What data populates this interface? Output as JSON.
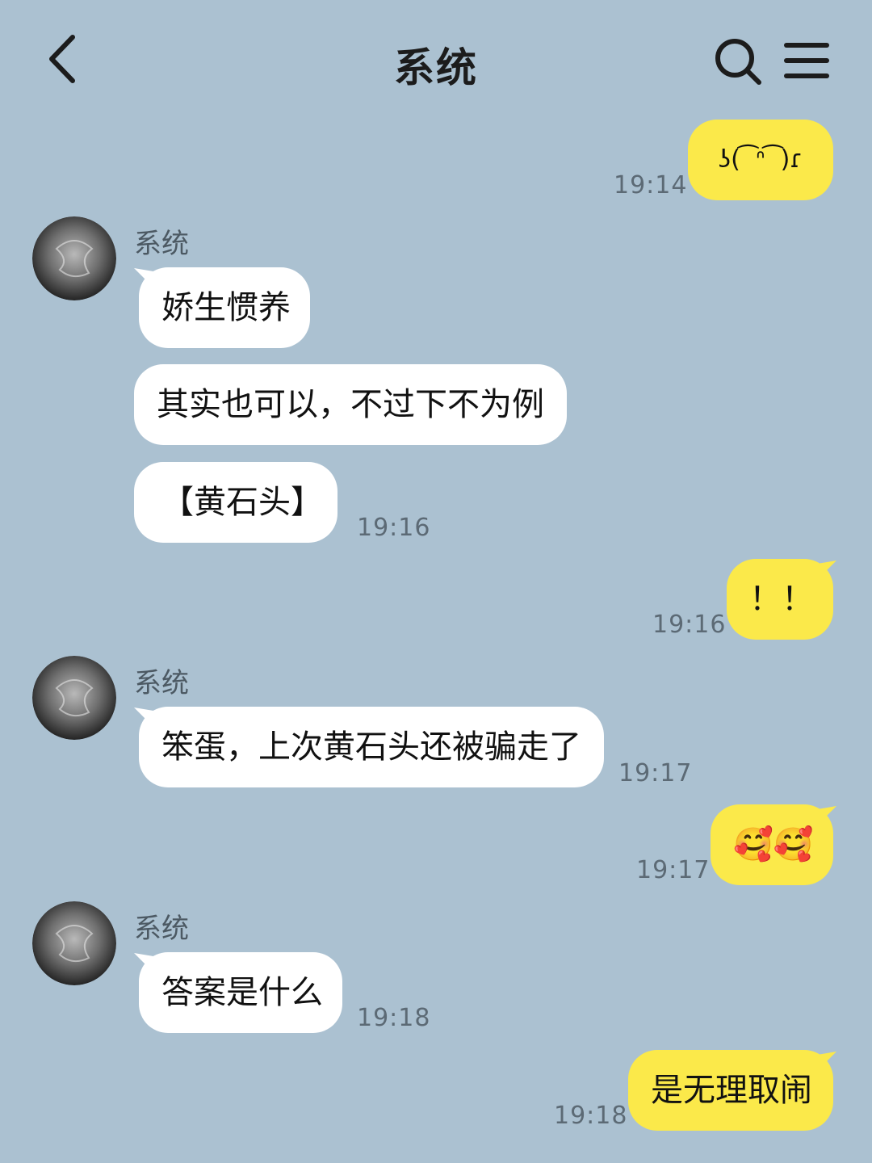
{
  "header": {
    "title": "系统",
    "back_icon": "chevron-left-icon",
    "search_icon": "search-icon",
    "menu_icon": "hamburger-menu-icon"
  },
  "colors": {
    "background": "#abc1d1",
    "incoming_bubble": "#ffffff",
    "outgoing_bubble": "#fbe94a"
  },
  "messages": [
    {
      "direction": "out",
      "text": "ʖ(  ͡ ᐢ ͡ )ɾ",
      "time": "19:14"
    },
    {
      "direction": "in",
      "sender": "系统",
      "text": "娇生惯养"
    },
    {
      "direction": "in",
      "text": "其实也可以，不过下不为例"
    },
    {
      "direction": "in",
      "text": "【黄石头】",
      "time": "19:16"
    },
    {
      "direction": "out",
      "text": "！！",
      "time": "19:16"
    },
    {
      "direction": "in",
      "sender": "系统",
      "text": "笨蛋，上次黄石头还被骗走了",
      "time": "19:17"
    },
    {
      "direction": "out",
      "text": "🥰🥰",
      "time": "19:17"
    },
    {
      "direction": "in",
      "sender": "系统",
      "text": "答案是什么",
      "time": "19:18"
    },
    {
      "direction": "out",
      "text": "是无理取闹",
      "time": "19:18"
    }
  ]
}
